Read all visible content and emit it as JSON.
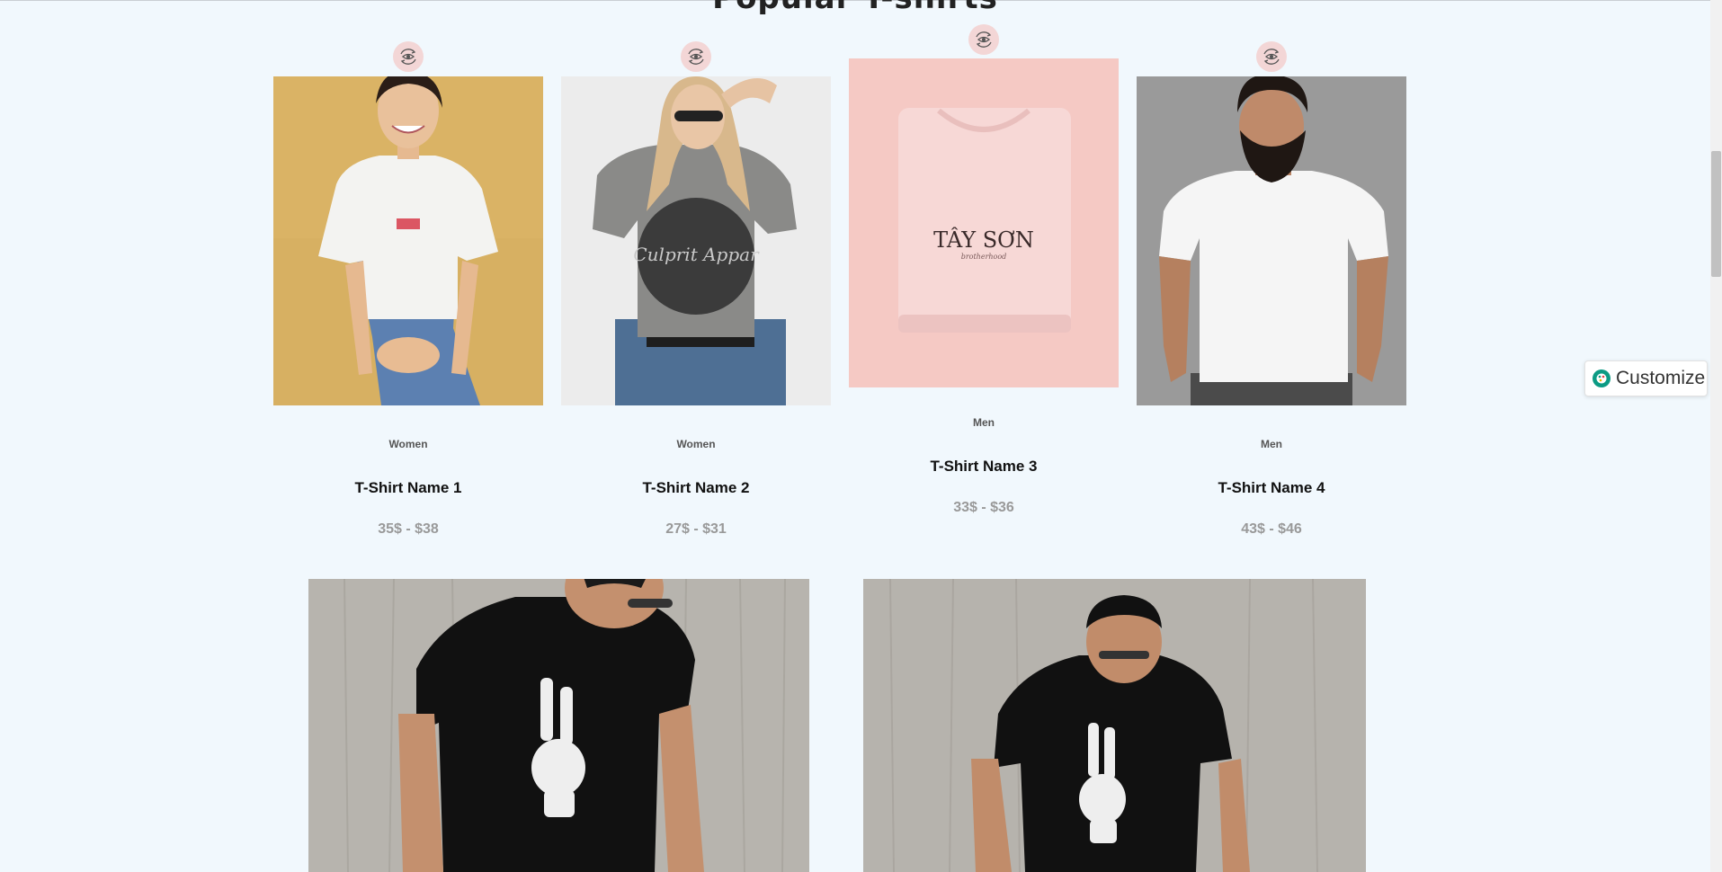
{
  "section": {
    "title": "Popular T-shirts"
  },
  "products": [
    {
      "category": "Women",
      "name": "T-Shirt Name 1",
      "price": "35$ - $38",
      "quickview_icon": "eye-rotate-icon"
    },
    {
      "category": "Women",
      "name": "T-Shirt Name 2",
      "price": "27$ - $31",
      "quickview_icon": "eye-rotate-icon"
    },
    {
      "category": "Men",
      "name": "T-Shirt Name 3",
      "price": "33$ - $36",
      "quickview_icon": "eye-rotate-icon"
    },
    {
      "category": "Men",
      "name": "T-Shirt Name 4",
      "price": "43$ - $46",
      "quickview_icon": "eye-rotate-icon"
    }
  ],
  "image_texts": {
    "shirt2_print": "Culprit Appar",
    "shirt3_brand": "TÂY SƠN",
    "shirt3_sub": "brotherhood"
  },
  "customize": {
    "label": "Customize",
    "icon": "palette-icon"
  },
  "colors": {
    "background": "#f1f8fd",
    "quickview_bg": "#f3d6d6",
    "price": "#999999",
    "customize_icon": "#0c9b84"
  }
}
